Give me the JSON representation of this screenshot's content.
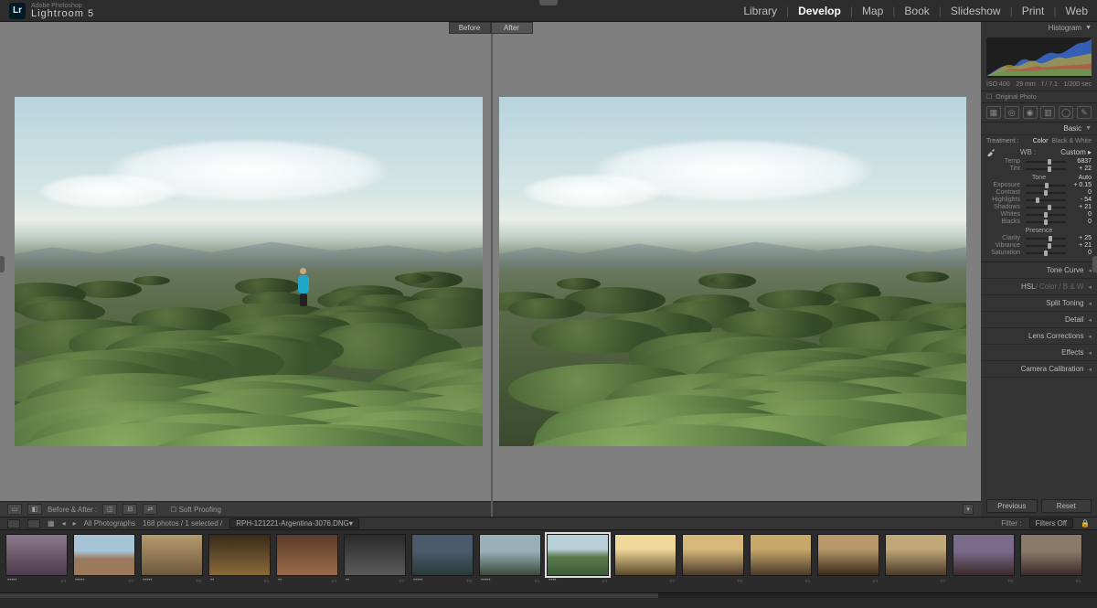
{
  "app": {
    "vendor": "Adobe Photoshop",
    "name": "Lightroom 5",
    "logo": "Lr"
  },
  "modules": [
    "Library",
    "Develop",
    "Map",
    "Book",
    "Slideshow",
    "Print",
    "Web"
  ],
  "active_module": "Develop",
  "compare": {
    "before": "Before",
    "after": "After"
  },
  "histogram": {
    "title": "Histogram",
    "iso": "ISO 400",
    "focal": "29 mm",
    "aperture": "f / 7.1",
    "shutter": "1/200 sec",
    "original": "Original Photo"
  },
  "tools": [
    "crop",
    "spot",
    "redeye",
    "gradient",
    "radial",
    "brush"
  ],
  "basic": {
    "title": "Basic",
    "treatment_label": "Treatment :",
    "treatment_options": [
      "Color",
      "Black & White"
    ],
    "treatment_selected": "Color",
    "wb_label": "WB :",
    "wb_value": "Custom",
    "sliders": {
      "temp": {
        "label": "Temp",
        "value": "6837",
        "pos": 58
      },
      "tint": {
        "label": "Tint",
        "value": "+ 22",
        "pos": 60
      },
      "tone_head": "Tone",
      "auto": "Auto",
      "exposure": {
        "label": "Exposure",
        "value": "+ 0.15",
        "pos": 52
      },
      "contrast": {
        "label": "Contrast",
        "value": "0",
        "pos": 50
      },
      "highlights": {
        "label": "Highlights",
        "value": "- 54",
        "pos": 30
      },
      "shadows": {
        "label": "Shadows",
        "value": "+ 21",
        "pos": 60
      },
      "whites": {
        "label": "Whites",
        "value": "0",
        "pos": 50
      },
      "blacks": {
        "label": "Blacks",
        "value": "0",
        "pos": 50
      },
      "presence_head": "Presence",
      "clarity": {
        "label": "Clarity",
        "value": "+ 25",
        "pos": 62
      },
      "vibrance": {
        "label": "Vibrance",
        "value": "+ 21",
        "pos": 60
      },
      "saturation": {
        "label": "Saturation",
        "value": "0",
        "pos": 50
      }
    }
  },
  "panels": [
    "Tone Curve",
    "HSL / Color / B & W",
    "Split Toning",
    "Detail",
    "Lens Corrections",
    "Effects",
    "Camera Calibration"
  ],
  "buttons": {
    "previous": "Previous",
    "reset": "Reset"
  },
  "toolbar": {
    "before_after": "Before & After :",
    "soft_proof": "Soft Proofing"
  },
  "strip": {
    "source": "All Photographs",
    "count": "168 photos / 1 selected /",
    "file": "RPH-121221-Argentina-3076.DNG",
    "filter_label": "Filter :",
    "filter_value": "Filters Off"
  },
  "thumbs": [
    {
      "g": "linear-gradient(#8a7a8a,#4a3a4a)",
      "stars": "•••••"
    },
    {
      "g": "linear-gradient(#a7c4d6 40%,#9a7a5a 60%)",
      "stars": "•••••"
    },
    {
      "g": "linear-gradient(#b59a6e,#6e5a3e)",
      "stars": "•••••"
    },
    {
      "g": "linear-gradient(#3a2a1a,#8a6a3a)",
      "stars": "••"
    },
    {
      "g": "linear-gradient(#5a3a2a,#9a6a4a)",
      "stars": "••"
    },
    {
      "g": "linear-gradient(#2a2a2a,#5a5a5a)",
      "stars": "••"
    },
    {
      "g": "linear-gradient(#4a5a6a 40%,#2a3a3a)",
      "stars": "•••••"
    },
    {
      "g": "linear-gradient(#9ab0b8 40%,#3a4a3a)",
      "stars": "•••••"
    },
    {
      "g": "linear-gradient(#b8d0d8 35%,#5a7a4a 55%,#3a5a3a)",
      "stars": "••••",
      "sel": true
    },
    {
      "g": "linear-gradient(#f0d89a 35%,#5a4a2a)",
      "stars": ""
    },
    {
      "g": "linear-gradient(#d8b87a 35%,#4a3a2a)",
      "stars": ""
    },
    {
      "g": "linear-gradient(#c8a86a 35%,#4a3a2a)",
      "stars": ""
    },
    {
      "g": "linear-gradient(#b8986a 35%,#3a2a1a)",
      "stars": ""
    },
    {
      "g": "linear-gradient(#c0a878 35%,#4a3a2a)",
      "stars": ""
    },
    {
      "g": "linear-gradient(#7a6a8a 40%,#3a2a2a)",
      "stars": ""
    },
    {
      "g": "linear-gradient(#8a7a6a 40%,#3a2a2a)",
      "stars": ""
    }
  ]
}
